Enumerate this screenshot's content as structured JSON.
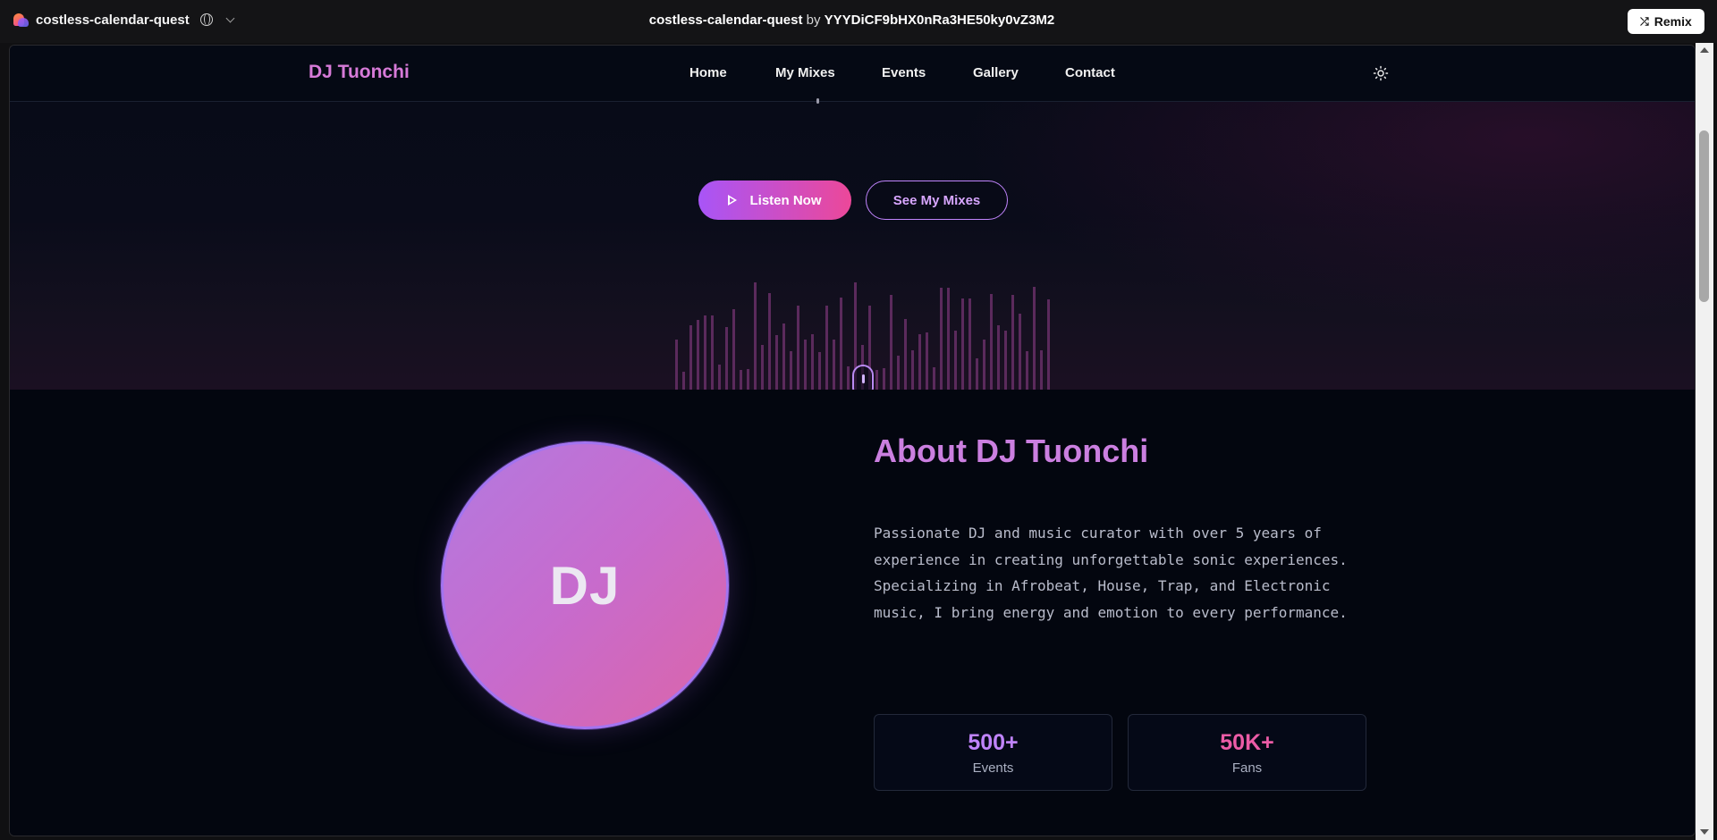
{
  "appbar": {
    "project_name": "costless-calendar-quest",
    "title_project": "costless-calendar-quest",
    "title_by": " by ",
    "title_user": "YYYDiCF9bHX0nRa3HE50ky0vZ3M2",
    "remix_label": "Remix",
    "icons": [
      "logo-mark",
      "globe-icon",
      "chevron-down-icon",
      "shuffle-icon"
    ]
  },
  "site": {
    "brand": "DJ Tuonchi",
    "nav": [
      {
        "label": "Home"
      },
      {
        "label": "My Mixes"
      },
      {
        "label": "Events"
      },
      {
        "label": "Gallery"
      },
      {
        "label": "Contact"
      }
    ],
    "theme_toggle_icon": "sun-icon"
  },
  "hero": {
    "listen_label": "Listen Now",
    "mixes_label": "See My Mixes",
    "scroll_icon": "mouse-icon",
    "equalizer_levels": [
      0.47,
      0.17,
      0.6,
      0.65,
      0.69,
      0.69,
      0.23,
      0.58,
      0.75,
      0.18,
      0.19,
      1.0,
      0.42,
      0.9,
      0.51,
      0.62,
      0.36,
      0.78,
      0.47,
      0.52,
      0.35,
      0.78,
      0.47,
      0.86,
      0.22,
      1.0,
      0.42,
      0.78,
      0.18,
      0.2,
      0.88,
      0.32,
      0.66,
      0.37,
      0.52,
      0.53,
      0.21,
      0.95,
      0.95,
      0.55,
      0.85,
      0.85,
      0.29,
      0.47,
      0.89,
      0.6,
      0.55,
      0.88,
      0.71,
      0.36,
      0.96,
      0.37,
      0.84
    ]
  },
  "about": {
    "avatar_text": "DJ",
    "title": "About DJ Tuonchi",
    "text": "Passionate DJ and music curator with over 5 years of experience in creating unforgettable sonic experiences. Specializing in Afrobeat, House, Trap, and Electronic music, I bring energy and emotion to every performance.",
    "stats": [
      {
        "value": "500+",
        "label": "Events",
        "color": "#c084fc"
      },
      {
        "value": "50K+",
        "label": "Fans",
        "color": "#ec5ca6"
      }
    ]
  },
  "colors": {
    "accent_purple": "#a855f7",
    "accent_pink": "#ec4899",
    "brand": "#d77ad8",
    "background": "#03060f"
  }
}
